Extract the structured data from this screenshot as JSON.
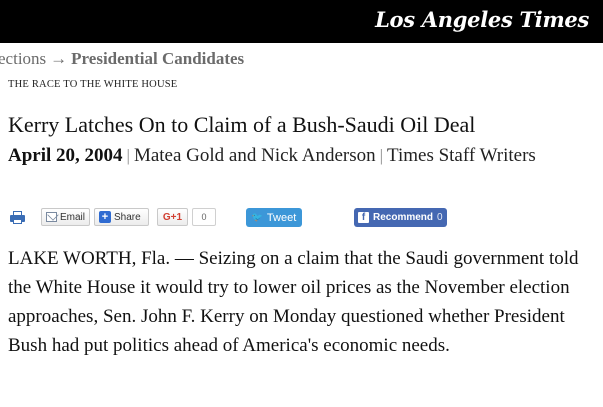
{
  "masthead": {
    "title": "Los Angeles Times"
  },
  "breadcrumb": {
    "previous": "ections",
    "arrow": "→",
    "current": "Presidential Candidates"
  },
  "article": {
    "kicker": "THE RACE TO THE WHITE HOUSE",
    "headline": "Kerry Latches On to Claim of a Bush-Saudi Oil Deal",
    "date": "April 20, 2004",
    "authors": "Matea Gold and Nick Anderson",
    "role": "Times Staff Writers",
    "separator": "|",
    "body": "LAKE WORTH, Fla. — Seizing on a claim that the Saudi government told the White House it would try to lower oil prices as the November election approaches, Sen. John F. Kerry on Monday questioned whether President Bush had put politics ahead of America's economic needs."
  },
  "share": {
    "print_icon": "printer-icon",
    "email_label": "Email",
    "share_label": "Share",
    "share_icon_glyph": "+",
    "gplus_label": "G+1",
    "gplus_count": "0",
    "tweet_label": "Tweet",
    "tweet_icon_glyph": "🐦",
    "fb_icon_glyph": "f",
    "fb_label": "Recommend",
    "fb_count": "0"
  },
  "colors": {
    "topbar": "#000000",
    "tweet": "#3c97d8",
    "facebook": "#4568b2"
  }
}
